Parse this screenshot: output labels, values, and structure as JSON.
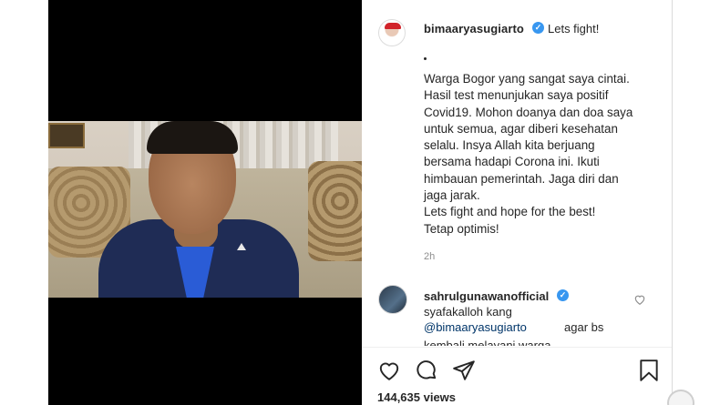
{
  "video": {
    "label": "Video preview"
  },
  "post": {
    "username": "bimaaryasugiarto",
    "caption_head": "Lets fight!",
    "caption_lines": [
      "Warga Bogor yang sangat saya cintai.",
      "Hasil test menunjukan saya positif",
      "Covid19. Mohon doanya dan doa saya",
      "untuk semua, agar diberi kesehatan",
      "selalu. Insya Allah kita berjuang",
      "bersama hadapi Corona ini. Ikuti",
      "himbauan pemerintah. Jaga diri dan",
      "jaga jarak.",
      "Lets fight and hope for the best!",
      "Tetap optimis!"
    ],
    "time": "2h"
  },
  "comment": {
    "username": "sahrulgunawanofficial",
    "text_line1": "syafakalloh kang",
    "mention": "@bimaaryasugiarto",
    "text_line2": "agar bs",
    "text_cut": "kembali melayani warga"
  },
  "actions": {
    "views": "144,635 views"
  },
  "colors": {
    "verified": "#3897f0",
    "mention": "#003569",
    "muted": "#8e8e8e"
  },
  "icons": [
    "heart-icon",
    "comment-icon",
    "share-icon",
    "bookmark-icon",
    "verified-badge-icon"
  ]
}
